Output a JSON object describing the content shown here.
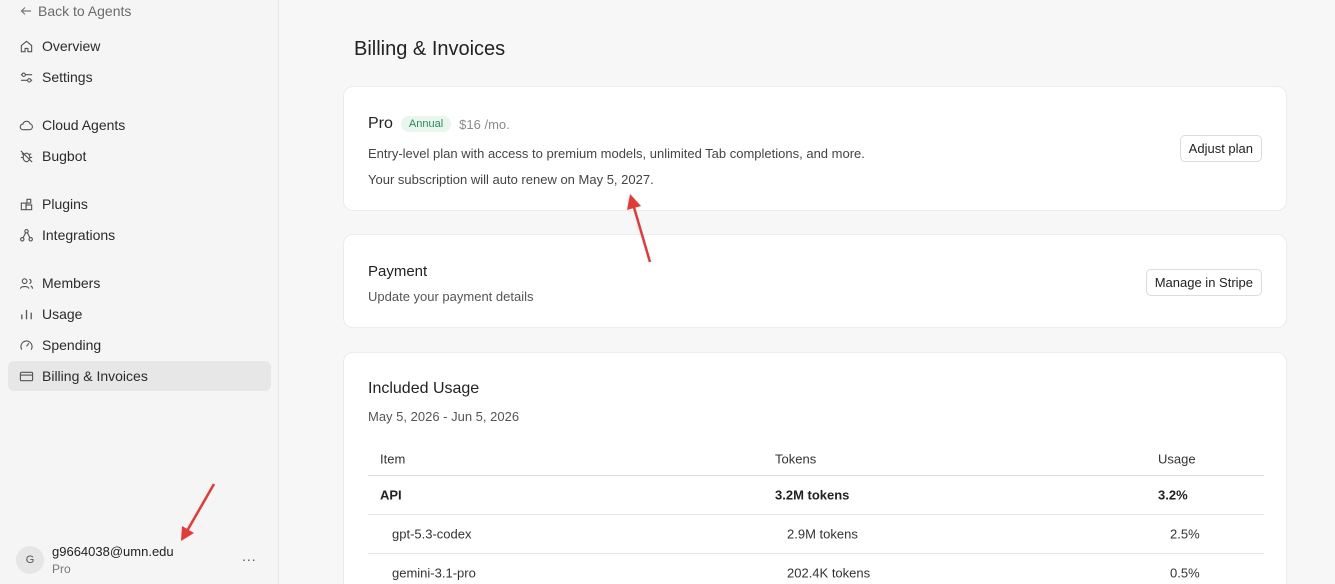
{
  "sidebar": {
    "back_label": "Back to Agents",
    "items": [
      {
        "label": "Overview",
        "icon": "home-icon"
      },
      {
        "label": "Settings",
        "icon": "sliders-icon"
      },
      {
        "label": "Cloud Agents",
        "icon": "cloud-icon"
      },
      {
        "label": "Bugbot",
        "icon": "bug-off-icon"
      },
      {
        "label": "Plugins",
        "icon": "puzzle-icon"
      },
      {
        "label": "Integrations",
        "icon": "integrations-icon"
      },
      {
        "label": "Members",
        "icon": "members-icon"
      },
      {
        "label": "Usage",
        "icon": "bar-chart-icon"
      },
      {
        "label": "Spending",
        "icon": "gauge-icon"
      },
      {
        "label": "Billing & Invoices",
        "icon": "card-icon"
      }
    ],
    "active_item": "Billing & Invoices",
    "user": {
      "avatar_initial": "G",
      "email": "g9664038@umn.edu",
      "plan": "Pro",
      "more": "..."
    }
  },
  "main": {
    "page_title": "Billing & Invoices",
    "plan_card": {
      "plan_name": "Pro",
      "billing_badge": "Annual",
      "price": "$16 /mo.",
      "description": "Entry-level plan with access to premium models, unlimited Tab completions, and more.",
      "renewal": "Your subscription will auto renew on May 5, 2027.",
      "adjust_button": "Adjust plan"
    },
    "payment_card": {
      "title": "Payment",
      "subtitle": "Update your payment details",
      "stripe_button": "Manage in Stripe"
    },
    "usage_card": {
      "title": "Included Usage",
      "date_range": "May 5, 2026 - Jun 5, 2026",
      "columns": [
        "Item",
        "Tokens",
        "Usage"
      ],
      "rows": [
        {
          "item": "API",
          "tokens": "3.2M tokens",
          "usage": "3.2%",
          "bold": true
        },
        {
          "item": "gpt-5.3-codex",
          "tokens": "2.9M tokens",
          "usage": "2.5%",
          "bold": false
        },
        {
          "item": "gemini-3.1-pro",
          "tokens": "202.4K tokens",
          "usage": "0.5%",
          "bold": false
        }
      ]
    }
  },
  "colors": {
    "annotation_arrow": "#e53935",
    "badge_text": "#2e8b57",
    "badge_bg": "#e8f6ee",
    "active_nav_bg": "#e7e7e7"
  }
}
